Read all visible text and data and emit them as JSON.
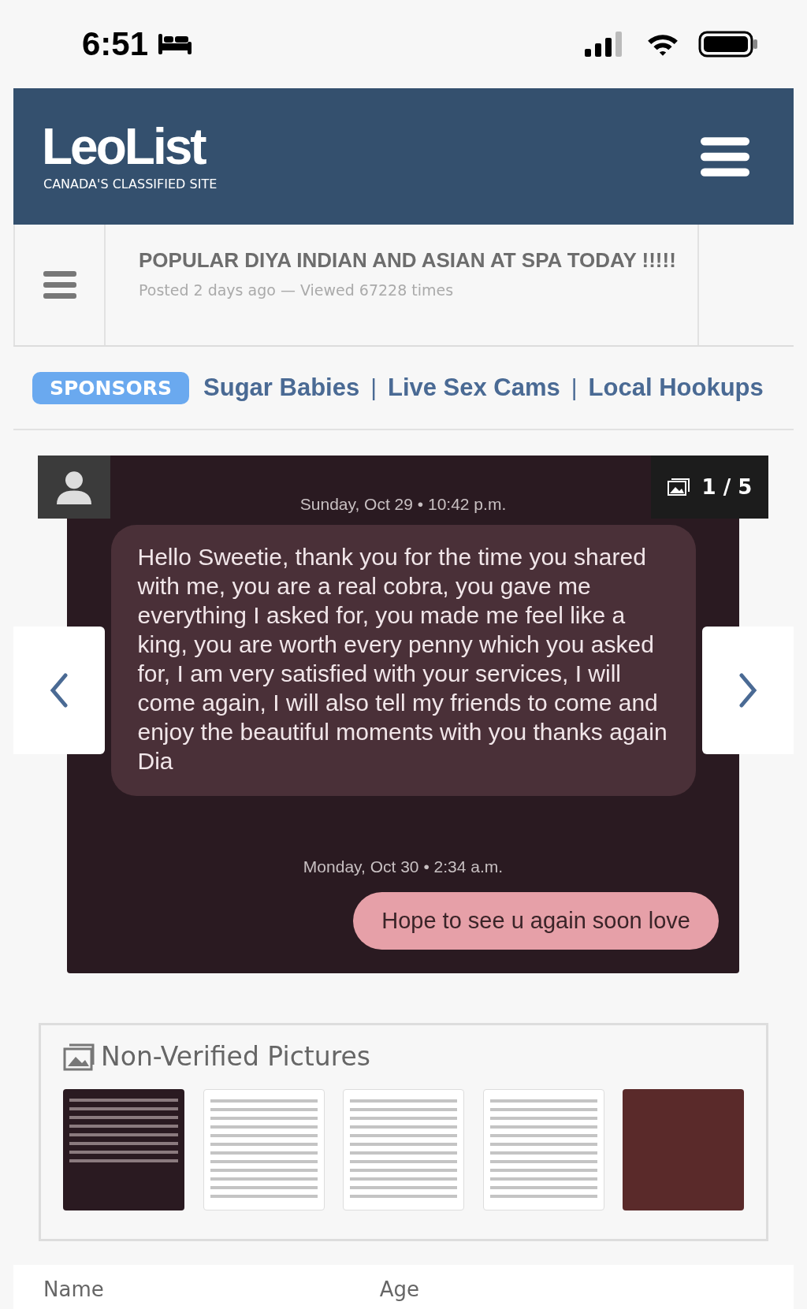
{
  "status_bar": {
    "time": "6:51"
  },
  "header": {
    "logo": "LeoList",
    "tagline": "CANADA'S CLASSIFIED SITE"
  },
  "post": {
    "title": "POPULAR DIYA INDIAN AND ASIAN AT SPA TODAY !!!!!",
    "meta": "Posted 2 days ago — Viewed 67228 times"
  },
  "sponsors": {
    "badge": "SPONSORS",
    "items": [
      {
        "kind": "link",
        "text": "Sugar Babies"
      },
      {
        "kind": "separator",
        "text": "|"
      },
      {
        "kind": "link",
        "text": "Live Sex Cams"
      },
      {
        "kind": "separator",
        "text": "|"
      },
      {
        "kind": "link",
        "text": "Local Hookups"
      }
    ]
  },
  "gallery": {
    "counter": "1 / 5",
    "messages": [
      {
        "kind": "timestamp",
        "text": "Sunday, Oct 29 • 10:42 p.m."
      },
      {
        "kind": "received",
        "text": "Hello Sweetie, thank you for the time you shared with me, you are a real cobra, you gave me everything I asked for, you made me feel like a king, you are worth every penny which you asked for, I am very satisfied with your services, I will come again, I will also tell my friends to come and enjoy the beautiful moments with you thanks again Dia"
      },
      {
        "kind": "timestamp",
        "text": "Monday, Oct 30 • 2:34 a.m."
      },
      {
        "kind": "sent",
        "text": "Hope to see u again soon love"
      }
    ]
  },
  "pictures": {
    "title": "Non-Verified Pictures",
    "thumbnails": [
      {
        "kind": "dark"
      },
      {
        "kind": "light"
      },
      {
        "kind": "light"
      },
      {
        "kind": "light"
      },
      {
        "kind": "photo"
      }
    ]
  },
  "details": {
    "labels": [
      "Name",
      "Age"
    ]
  }
}
